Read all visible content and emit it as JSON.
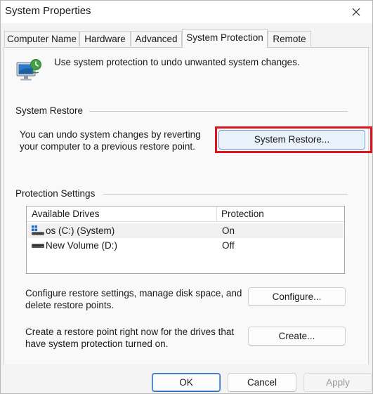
{
  "window": {
    "title": "System Properties"
  },
  "tabs": [
    {
      "label": "Computer Name",
      "active": false
    },
    {
      "label": "Hardware",
      "active": false
    },
    {
      "label": "Advanced",
      "active": false
    },
    {
      "label": "System Protection",
      "active": true
    },
    {
      "label": "Remote",
      "active": false
    }
  ],
  "intro": {
    "text": "Use system protection to undo unwanted system changes.",
    "icon": "system-protection-computer-icon"
  },
  "system_restore": {
    "group_label": "System Restore",
    "description_line1": "You can undo system changes by reverting",
    "description_line2": "your computer to a previous restore point.",
    "button_label": "System Restore..."
  },
  "protection_settings": {
    "group_label": "Protection Settings",
    "columns": {
      "drives": "Available Drives",
      "protection": "Protection"
    },
    "drives": [
      {
        "name": "os (C:) (System)",
        "protection": "On",
        "icon": "windows-system-drive-icon",
        "selected": true
      },
      {
        "name": "New Volume (D:)",
        "protection": "Off",
        "icon": "hard-drive-icon",
        "selected": false
      }
    ],
    "configure_line1": "Configure restore settings, manage disk space, and",
    "configure_line2": "delete restore points.",
    "configure_button": "Configure...",
    "create_line1": "Create a restore point right now for the drives that",
    "create_line2": "have system protection turned on.",
    "create_button": "Create..."
  },
  "footer": {
    "ok": "OK",
    "cancel": "Cancel",
    "apply": "Apply",
    "apply_enabled": false
  },
  "colors": {
    "highlight": "#e0141e",
    "accent": "#2f6fc0"
  }
}
